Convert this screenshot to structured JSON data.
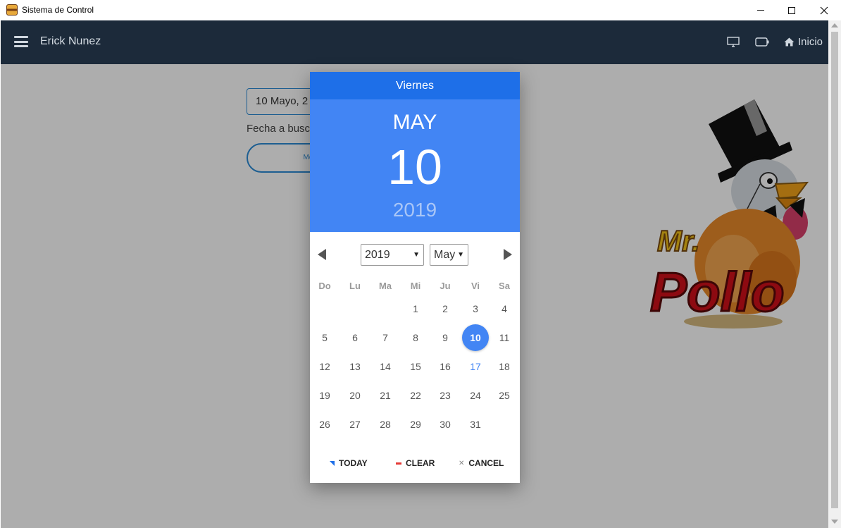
{
  "window": {
    "title": "Sistema de Control",
    "app_icon": "burger-icon",
    "controls": [
      "minimize",
      "maximize",
      "close"
    ]
  },
  "navbar": {
    "user_name": "Erick Nunez",
    "menu_icon": "hamburger-icon",
    "icons": [
      "monitor-icon",
      "battery-icon"
    ],
    "home_label": "Inicio",
    "home_icon": "home-icon",
    "background": "#1c2a3a"
  },
  "page": {
    "date_input_value": "10 Mayo, 2",
    "date_hint": "Fecha a busc",
    "show_button_label": "Mos"
  },
  "logo": {
    "text_top": "Mr.",
    "text_main": "Pollo"
  },
  "picker": {
    "weekday": "Viernes",
    "month": "MAY",
    "day": "10",
    "year": "2019",
    "year_select": "2019",
    "month_select": "May",
    "weekday_headers": [
      "Do",
      "Lu",
      "Ma",
      "Mi",
      "Ju",
      "Vi",
      "Sa"
    ],
    "weeks": [
      [
        "",
        "",
        "",
        "1",
        "2",
        "3",
        "4"
      ],
      [
        "5",
        "6",
        "7",
        "8",
        "9",
        "10",
        "11"
      ],
      [
        "12",
        "13",
        "14",
        "15",
        "16",
        "17",
        "18"
      ],
      [
        "19",
        "20",
        "21",
        "22",
        "23",
        "24",
        "25"
      ],
      [
        "26",
        "27",
        "28",
        "29",
        "30",
        "31",
        ""
      ]
    ],
    "selected_day": "10",
    "today_day": "17",
    "buttons": {
      "today": "TODAY",
      "clear": "CLEAR",
      "cancel": "CANCEL"
    },
    "header_color": "#4285f4",
    "weekday_bar_color": "#1e6fe8"
  }
}
